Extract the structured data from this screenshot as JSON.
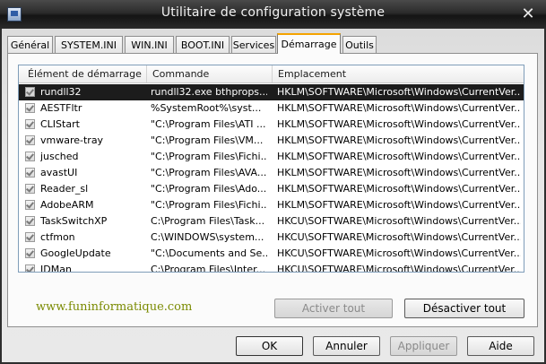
{
  "window": {
    "title": "Utilitaire de configuration système"
  },
  "tabs": [
    {
      "label": "Général"
    },
    {
      "label": "SYSTEM.INI"
    },
    {
      "label": "WIN.INI"
    },
    {
      "label": "BOOT.INI"
    },
    {
      "label": "Services"
    },
    {
      "label": "Démarrage",
      "active": true
    },
    {
      "label": "Outils"
    }
  ],
  "list": {
    "columns": [
      "Élément de démarrage",
      "Commande",
      "Emplacement"
    ],
    "rows": [
      {
        "checked": true,
        "item": "rundll32",
        "command": "rundll32.exe bthprops...",
        "location": "HKLM\\SOFTWARE\\Microsoft\\Windows\\CurrentVer...",
        "selected": true
      },
      {
        "checked": true,
        "item": "AESTFltr",
        "command": "%SystemRoot%\\syst...",
        "location": "HKLM\\SOFTWARE\\Microsoft\\Windows\\CurrentVer..."
      },
      {
        "checked": true,
        "item": "CLIStart",
        "command": "\"C:\\Program Files\\ATI ...",
        "location": "HKLM\\SOFTWARE\\Microsoft\\Windows\\CurrentVer..."
      },
      {
        "checked": true,
        "item": "vmware-tray",
        "command": "\"C:\\Program Files\\VM...",
        "location": "HKLM\\SOFTWARE\\Microsoft\\Windows\\CurrentVer..."
      },
      {
        "checked": true,
        "item": "jusched",
        "command": "\"C:\\Program Files\\Fichi...",
        "location": "HKLM\\SOFTWARE\\Microsoft\\Windows\\CurrentVer..."
      },
      {
        "checked": true,
        "item": "avastUI",
        "command": "\"C:\\Program Files\\AVA...",
        "location": "HKLM\\SOFTWARE\\Microsoft\\Windows\\CurrentVer..."
      },
      {
        "checked": true,
        "item": "Reader_sl",
        "command": "\"C:\\Program Files\\Ado...",
        "location": "HKLM\\SOFTWARE\\Microsoft\\Windows\\CurrentVer..."
      },
      {
        "checked": true,
        "item": "AdobeARM",
        "command": "\"C:\\Program Files\\Fichi...",
        "location": "HKLM\\SOFTWARE\\Microsoft\\Windows\\CurrentVer..."
      },
      {
        "checked": true,
        "item": "TaskSwitchXP",
        "command": "C:\\Program Files\\Task...",
        "location": "HKCU\\SOFTWARE\\Microsoft\\Windows\\CurrentVer..."
      },
      {
        "checked": true,
        "item": "ctfmon",
        "command": "C:\\WINDOWS\\system...",
        "location": "HKCU\\SOFTWARE\\Microsoft\\Windows\\CurrentVer..."
      },
      {
        "checked": true,
        "item": "GoogleUpdate",
        "command": "\"C:\\Documents and Se...",
        "location": "HKCU\\SOFTWARE\\Microsoft\\Windows\\CurrentVer..."
      },
      {
        "checked": true,
        "item": "IDMan",
        "command": "C:\\Program Files\\Inter...",
        "location": "HKCU\\SOFTWARE\\Microsoft\\Windows\\CurrentVer..."
      }
    ]
  },
  "watermark": "www.funinformatique.com",
  "buttons": {
    "enable_all": "Activer tout",
    "disable_all": "Désactiver tout",
    "ok": "OK",
    "cancel": "Annuler",
    "apply": "Appliquer",
    "help": "Aide"
  },
  "colors": {
    "selected_row": "#1c1c1c",
    "watermark": "#7a8a00",
    "active_tab_accent": "#f4a300"
  }
}
